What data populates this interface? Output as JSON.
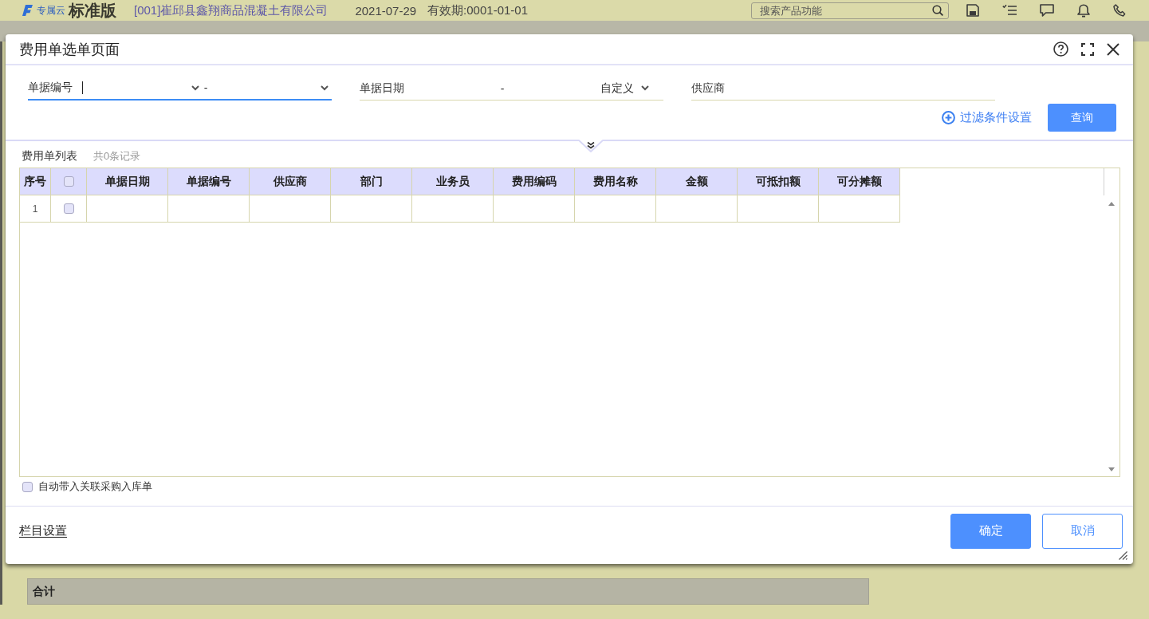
{
  "app_bar": {
    "brand_tag": "专属云",
    "edition": "标准版",
    "company": "[001]崔邱县鑫翔商品混凝土有限公司",
    "login_date": "2021-07-29",
    "validity": "有效期:0001-01-01",
    "search": {
      "placeholder": "搜索产品功能"
    }
  },
  "dialog": {
    "title": "费用单选单页面",
    "filters": [
      {
        "kind": "range",
        "label": "单据编号",
        "focused": true,
        "separator": "-"
      },
      {
        "kind": "date_range",
        "label": "单据日期",
        "focused": false,
        "separator": "-",
        "preset": "自定义"
      },
      {
        "kind": "text",
        "label": "供应商",
        "focused": false
      }
    ],
    "filter_settings": "过滤条件设置",
    "query_button": "查询",
    "list": {
      "title": "费用单列表",
      "record_count": "共0条记录",
      "columns": [
        {
          "kind": "index",
          "label": "序号"
        },
        {
          "kind": "checkbox",
          "checked": false
        },
        {
          "kind": "text",
          "label": "单据日期"
        },
        {
          "kind": "text",
          "label": "单据编号"
        },
        {
          "kind": "text",
          "label": "供应商"
        },
        {
          "kind": "text",
          "label": "部门"
        },
        {
          "kind": "text",
          "label": "业务员"
        },
        {
          "kind": "text",
          "label": "费用编码"
        },
        {
          "kind": "text",
          "label": "费用名称"
        },
        {
          "kind": "text",
          "label": "金额"
        },
        {
          "kind": "text",
          "label": "可抵扣额"
        },
        {
          "kind": "text",
          "label": "可分摊额"
        }
      ],
      "rows": [
        {
          "index": "1",
          "checked": false
        }
      ]
    },
    "auto_import": {
      "label": "自动带入关联采购入库单",
      "checked": false
    },
    "column_settings": "栏目设置",
    "buttons": [
      {
        "label": "确定",
        "kind": "primary"
      },
      {
        "label": "取消",
        "kind": "secondary"
      }
    ]
  },
  "summary_bar": {
    "label": "合计"
  }
}
